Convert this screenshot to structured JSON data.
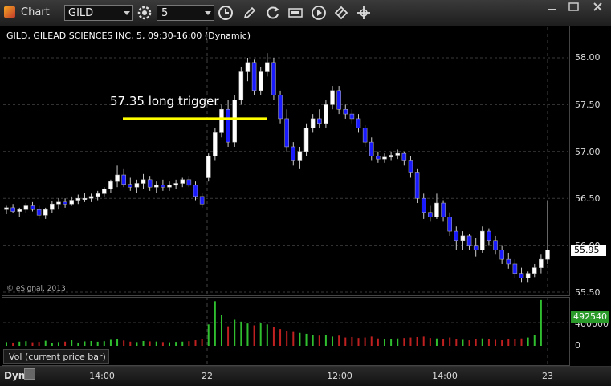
{
  "toolbar": {
    "app_title": "Chart",
    "symbol": "GILD",
    "interval": "5",
    "icons": [
      "gear-icon",
      "clock-icon",
      "pencil-icon",
      "refresh-icon",
      "quote-icon",
      "play-icon",
      "eraser-icon"
    ]
  },
  "chart": {
    "header": "GILD, GILEAD SCIENCES INC, 5, 09:30-16:00 (Dynamic)",
    "copyright": "© eSignal, 2013",
    "annotation": "57.35 long trigger",
    "annotation_price": 57.35,
    "last_price": "55.95"
  },
  "price_axis": [
    "58.00",
    "57.50",
    "57.00",
    "56.50",
    "56.00",
    "55.50"
  ],
  "volume": {
    "label": "Vol (current price bar)",
    "current": "492540",
    "ticks": [
      "400000",
      "0"
    ]
  },
  "time_axis": [
    "14:00",
    "22",
    "12:00",
    "14:00",
    "23"
  ],
  "bottom": {
    "mode": "Dyn"
  },
  "colors": {
    "up": "#ffffff",
    "down": "#1a1aff",
    "annotation": "#ffff00",
    "vol_up": "#2fbf2f",
    "vol_down": "#c02020"
  },
  "chart_data": {
    "type": "candlestick",
    "symbol": "GILD",
    "interval_minutes": 5,
    "ylim": [
      55.45,
      58.1
    ],
    "candles": [
      [
        56.38,
        56.42,
        56.33,
        56.4
      ],
      [
        56.4,
        56.44,
        56.34,
        56.36
      ],
      [
        56.36,
        56.4,
        56.3,
        56.38
      ],
      [
        56.38,
        56.45,
        56.34,
        56.42
      ],
      [
        56.42,
        56.46,
        56.36,
        56.38
      ],
      [
        56.38,
        56.42,
        56.28,
        56.32
      ],
      [
        56.32,
        56.4,
        56.28,
        56.38
      ],
      [
        56.38,
        56.47,
        56.34,
        56.44
      ],
      [
        56.44,
        56.5,
        56.38,
        56.46
      ],
      [
        56.46,
        56.5,
        56.4,
        56.44
      ],
      [
        56.44,
        56.52,
        56.42,
        56.48
      ],
      [
        56.48,
        56.54,
        56.44,
        56.5
      ],
      [
        56.5,
        56.56,
        56.46,
        56.5
      ],
      [
        56.5,
        56.55,
        56.46,
        56.52
      ],
      [
        56.52,
        56.58,
        56.48,
        56.55
      ],
      [
        56.55,
        56.62,
        56.52,
        56.6
      ],
      [
        56.6,
        56.7,
        56.56,
        56.68
      ],
      [
        56.68,
        56.85,
        56.62,
        56.75
      ],
      [
        56.75,
        56.82,
        56.62,
        56.65
      ],
      [
        56.65,
        56.72,
        56.58,
        56.62
      ],
      [
        56.62,
        56.7,
        56.56,
        56.66
      ],
      [
        56.66,
        56.76,
        56.6,
        56.7
      ],
      [
        56.7,
        56.74,
        56.58,
        56.62
      ],
      [
        56.62,
        56.68,
        56.56,
        56.64
      ],
      [
        56.64,
        56.7,
        56.58,
        56.62
      ],
      [
        56.62,
        56.68,
        56.58,
        56.64
      ],
      [
        56.64,
        56.7,
        56.6,
        56.66
      ],
      [
        56.66,
        56.72,
        56.62,
        56.7
      ],
      [
        56.7,
        56.74,
        56.62,
        56.64
      ],
      [
        56.64,
        56.68,
        56.48,
        56.52
      ],
      [
        56.52,
        56.56,
        56.4,
        56.44
      ],
      [
        56.72,
        56.98,
        56.68,
        56.95
      ],
      [
        56.95,
        57.25,
        56.9,
        57.2
      ],
      [
        57.2,
        57.5,
        57.15,
        57.45
      ],
      [
        57.45,
        57.55,
        57.05,
        57.1
      ],
      [
        57.1,
        57.6,
        57.05,
        57.55
      ],
      [
        57.55,
        57.9,
        57.5,
        57.85
      ],
      [
        57.85,
        58.0,
        57.75,
        57.95
      ],
      [
        57.95,
        57.98,
        57.6,
        57.65
      ],
      [
        57.65,
        57.9,
        57.6,
        57.85
      ],
      [
        57.85,
        58.05,
        57.8,
        57.95
      ],
      [
        57.95,
        58.0,
        57.55,
        57.6
      ],
      [
        57.6,
        57.65,
        57.3,
        57.35
      ],
      [
        57.35,
        57.45,
        57.0,
        57.05
      ],
      [
        57.05,
        57.1,
        56.85,
        56.9
      ],
      [
        56.9,
        57.05,
        56.82,
        57.0
      ],
      [
        57.0,
        57.3,
        56.95,
        57.25
      ],
      [
        57.25,
        57.4,
        57.2,
        57.35
      ],
      [
        57.35,
        57.45,
        57.25,
        57.3
      ],
      [
        57.3,
        57.55,
        57.25,
        57.5
      ],
      [
        57.5,
        57.7,
        57.45,
        57.65
      ],
      [
        57.65,
        57.7,
        57.4,
        57.45
      ],
      [
        57.45,
        57.5,
        57.35,
        57.4
      ],
      [
        57.4,
        57.45,
        57.3,
        57.35
      ],
      [
        57.35,
        57.4,
        57.2,
        57.25
      ],
      [
        57.25,
        57.28,
        57.05,
        57.1
      ],
      [
        57.1,
        57.15,
        56.9,
        56.95
      ],
      [
        56.95,
        57.0,
        56.88,
        56.92
      ],
      [
        56.92,
        56.98,
        56.88,
        56.94
      ],
      [
        56.94,
        57.0,
        56.9,
        56.96
      ],
      [
        56.96,
        57.02,
        56.92,
        56.98
      ],
      [
        56.98,
        57.0,
        56.85,
        56.9
      ],
      [
        56.9,
        56.95,
        56.72,
        56.78
      ],
      [
        56.78,
        56.82,
        56.45,
        56.5
      ],
      [
        56.5,
        56.55,
        56.28,
        56.35
      ],
      [
        56.35,
        56.42,
        56.25,
        56.3
      ],
      [
        56.3,
        56.55,
        56.28,
        56.45
      ],
      [
        56.45,
        56.48,
        56.25,
        56.3
      ],
      [
        56.3,
        56.35,
        56.1,
        56.15
      ],
      [
        56.15,
        56.2,
        55.95,
        56.05
      ],
      [
        56.05,
        56.15,
        55.95,
        56.1
      ],
      [
        56.1,
        56.12,
        55.95,
        56.0
      ],
      [
        56.0,
        56.08,
        55.88,
        55.95
      ],
      [
        55.95,
        56.2,
        55.92,
        56.15
      ],
      [
        56.15,
        56.18,
        56.0,
        56.05
      ],
      [
        56.05,
        56.1,
        55.9,
        55.95
      ],
      [
        55.95,
        56.0,
        55.8,
        55.85
      ],
      [
        55.85,
        55.92,
        55.75,
        55.8
      ],
      [
        55.8,
        55.85,
        55.65,
        55.7
      ],
      [
        55.7,
        55.76,
        55.6,
        55.65
      ],
      [
        55.65,
        55.72,
        55.6,
        55.7
      ],
      [
        55.7,
        55.8,
        55.66,
        55.76
      ],
      [
        55.76,
        55.9,
        55.7,
        55.85
      ],
      [
        55.85,
        56.48,
        55.8,
        55.95
      ]
    ],
    "volumes": [
      40000,
      35000,
      45000,
      50000,
      38000,
      42000,
      55000,
      30000,
      40000,
      45000,
      60000,
      35000,
      48000,
      52000,
      44000,
      50000,
      65000,
      70000,
      58000,
      45000,
      40000,
      52000,
      48000,
      46000,
      40000,
      38000,
      42000,
      45000,
      50000,
      60000,
      72000,
      230000,
      480000,
      330000,
      210000,
      280000,
      260000,
      240000,
      220000,
      250000,
      230000,
      200000,
      180000,
      160000,
      150000,
      140000,
      130000,
      120000,
      110000,
      115000,
      100000,
      110000,
      90000,
      95000,
      85000,
      90000,
      100000,
      80000,
      70000,
      75000,
      80000,
      85000,
      90000,
      95000,
      100000,
      85000,
      80000,
      75000,
      90000,
      70000,
      65000,
      60000,
      75000,
      80000,
      70000,
      65000,
      60000,
      70000,
      75000,
      80000,
      90000,
      120000,
      492540
    ]
  }
}
